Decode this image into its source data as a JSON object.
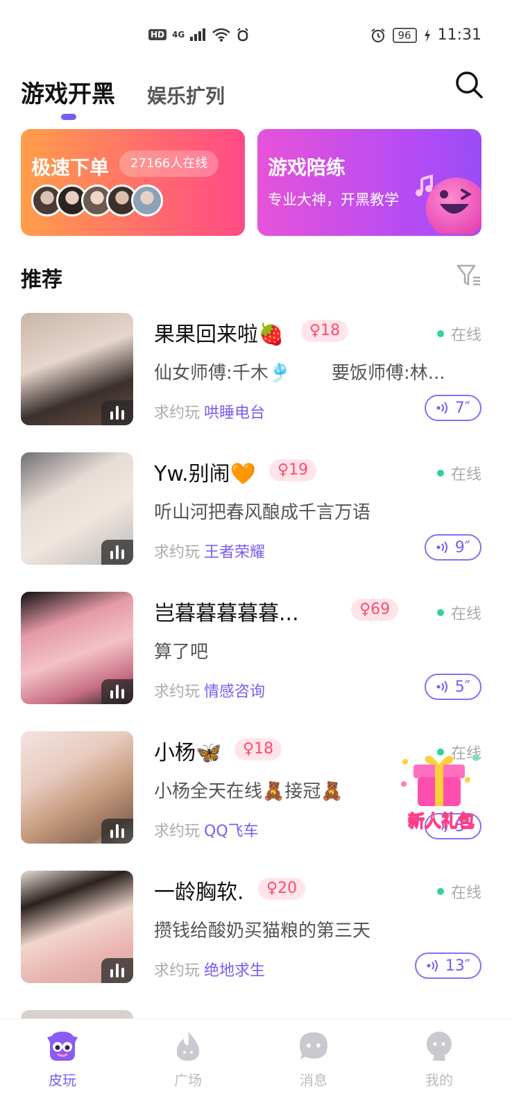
{
  "status_bar": {
    "hd": "HD",
    "network": "4G",
    "battery": "96",
    "time": "11:31"
  },
  "header": {
    "tabs": [
      {
        "label": "游戏开黑",
        "active": true
      },
      {
        "label": "娱乐扩列",
        "active": false
      }
    ],
    "search_icon": "search-icon"
  },
  "banners": {
    "left": {
      "title": "极速下单",
      "online_count": "27166人在线"
    },
    "right": {
      "title": "游戏陪练",
      "subtitle": "专业大神，开黑教学"
    }
  },
  "section": {
    "title": "推荐",
    "filter_icon": "filter-icon"
  },
  "list": [
    {
      "name": "果果回来啦🍓",
      "age": "♀18",
      "status": "在线",
      "signature": "仙女师傅:千木🎐",
      "signature2": "要饭师傅:林...",
      "prefix": "求约玩",
      "game": "哄睡电台",
      "voice": "7″"
    },
    {
      "name": "Yw.别闹🧡",
      "age": "♀19",
      "status": "在线",
      "signature": "听山河把春风酿成千言万语",
      "signature2": "",
      "prefix": "求约玩",
      "game": "王者荣耀",
      "voice": "9″"
    },
    {
      "name": "岂暮暮暮暮暮...",
      "age": "♀69",
      "status": "在线",
      "signature": "算了吧",
      "signature2": "",
      "prefix": "求约玩",
      "game": "情感咨询",
      "voice": "5″"
    },
    {
      "name": "小杨🦋",
      "age": "♀18",
      "status": "在线",
      "signature": "小杨全天在线🧸接冠🧸",
      "signature2": "",
      "prefix": "求约玩",
      "game": "QQ飞车",
      "voice": "5″"
    },
    {
      "name": "一龄胸软.",
      "age": "♀20",
      "status": "在线",
      "signature": "攒钱给酸奶买猫粮的第三天",
      "signature2": "",
      "prefix": "求约玩",
      "game": "绝地求生",
      "voice": "13″"
    }
  ],
  "gift": {
    "label": "新人礼包"
  },
  "bottom_nav": [
    {
      "label": "皮玩",
      "active": true
    },
    {
      "label": "广场",
      "active": false
    },
    {
      "label": "消息",
      "active": false
    },
    {
      "label": "我的",
      "active": false
    }
  ],
  "colors": {
    "accent": "#7b5cf0",
    "age_badge_bg": "#ffe5ea",
    "age_badge_text": "#ff4a6e",
    "online_dot": "#30d29a"
  }
}
